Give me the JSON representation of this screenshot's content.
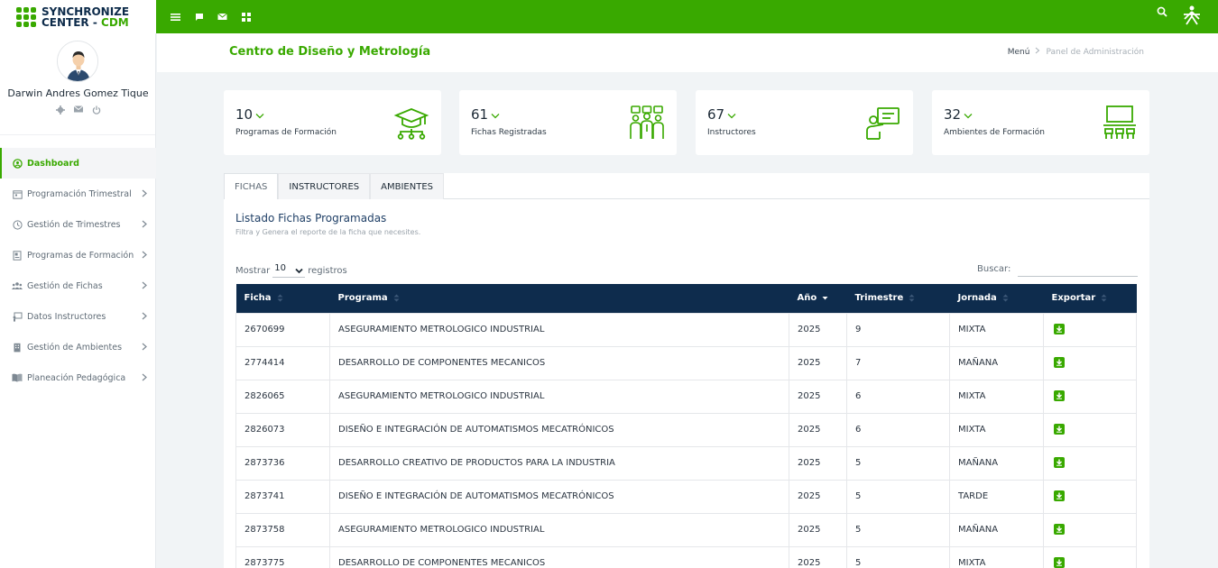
{
  "brand": {
    "line1": "SYNCHRONIZE",
    "line2": "CENTER - ",
    "line2_accent": "CDM",
    "accent_color": "#39a900",
    "navy_color": "#0e2c4d"
  },
  "topbar": {
    "icons": [
      "menu-icon",
      "chat-icon",
      "mail-icon",
      "grid-icon"
    ],
    "right_icons": [
      "search-icon",
      "sena-logo-icon"
    ]
  },
  "user": {
    "name": "Darwin Andres Gomez Tique",
    "actions": [
      "settings-icon",
      "mail-icon",
      "power-icon"
    ]
  },
  "sidebar": {
    "items": [
      {
        "label": "Dashboard",
        "icon": "dashboard-icon",
        "active": true
      },
      {
        "label": "Programación Trimestral",
        "icon": "calendar-icon"
      },
      {
        "label": "Gestión de Trimestres",
        "icon": "clock-icon"
      },
      {
        "label": "Programas de Formación",
        "icon": "document-icon"
      },
      {
        "label": "Gestión de Fichas",
        "icon": "users-icon"
      },
      {
        "label": "Datos Instructores",
        "icon": "id-card-icon"
      },
      {
        "label": "Gestión de Ambientes",
        "icon": "building-icon"
      },
      {
        "label": "Planeación Pedagógica",
        "icon": "book-icon"
      }
    ]
  },
  "header": {
    "title": "Centro de Diseño y Metrología",
    "breadcrumb_home": "Menú",
    "breadcrumb_current": "Panel de Administración"
  },
  "stats": [
    {
      "value": "10",
      "label": "Programas de Formación",
      "icon": "graduation-cap-icon"
    },
    {
      "value": "61",
      "label": "Fichas Registradas",
      "icon": "group-icon"
    },
    {
      "value": "67",
      "label": "Instructores",
      "icon": "teacher-icon"
    },
    {
      "value": "32",
      "label": "Ambientes de Formación",
      "icon": "classroom-icon"
    }
  ],
  "tabs": [
    "FICHAS",
    "INSTRUCTORES",
    "AMBIENTES"
  ],
  "listing": {
    "title": "Listado Fichas Programadas",
    "subtitle": "Filtra y Genera el reporte de la ficha que necesites.",
    "show_prefix": "Mostrar",
    "show_value": "10",
    "show_suffix": "registros",
    "search_label": "Buscar:"
  },
  "table": {
    "columns": [
      "Ficha",
      "Programa",
      "Año",
      "Trimestre",
      "Jornada",
      "Exportar"
    ],
    "rows": [
      [
        "2670699",
        "ASEGURAMIENTO METROLOGICO INDUSTRIAL",
        "2025",
        "9",
        "MIXTA"
      ],
      [
        "2774414",
        "DESARROLLO DE COMPONENTES MECANICOS",
        "2025",
        "7",
        "MAÑANA"
      ],
      [
        "2826065",
        "ASEGURAMIENTO METROLOGICO INDUSTRIAL",
        "2025",
        "6",
        "MIXTA"
      ],
      [
        "2826073",
        "DISEÑO E INTEGRACIÓN DE AUTOMATISMOS MECATRÓNICOS",
        "2025",
        "6",
        "MIXTA"
      ],
      [
        "2873736",
        "DESARROLLO CREATIVO DE PRODUCTOS PARA LA INDUSTRIA",
        "2025",
        "5",
        "MAÑANA"
      ],
      [
        "2873741",
        "DISEÑO E INTEGRACIÓN DE AUTOMATISMOS MECATRÓNICOS",
        "2025",
        "5",
        "TARDE"
      ],
      [
        "2873758",
        "ASEGURAMIENTO METROLOGICO INDUSTRIAL",
        "2025",
        "5",
        "MAÑANA"
      ],
      [
        "2873775",
        "DESARROLLO DE COMPONENTES MECANICOS",
        "2025",
        "5",
        "MIXTA"
      ]
    ]
  }
}
